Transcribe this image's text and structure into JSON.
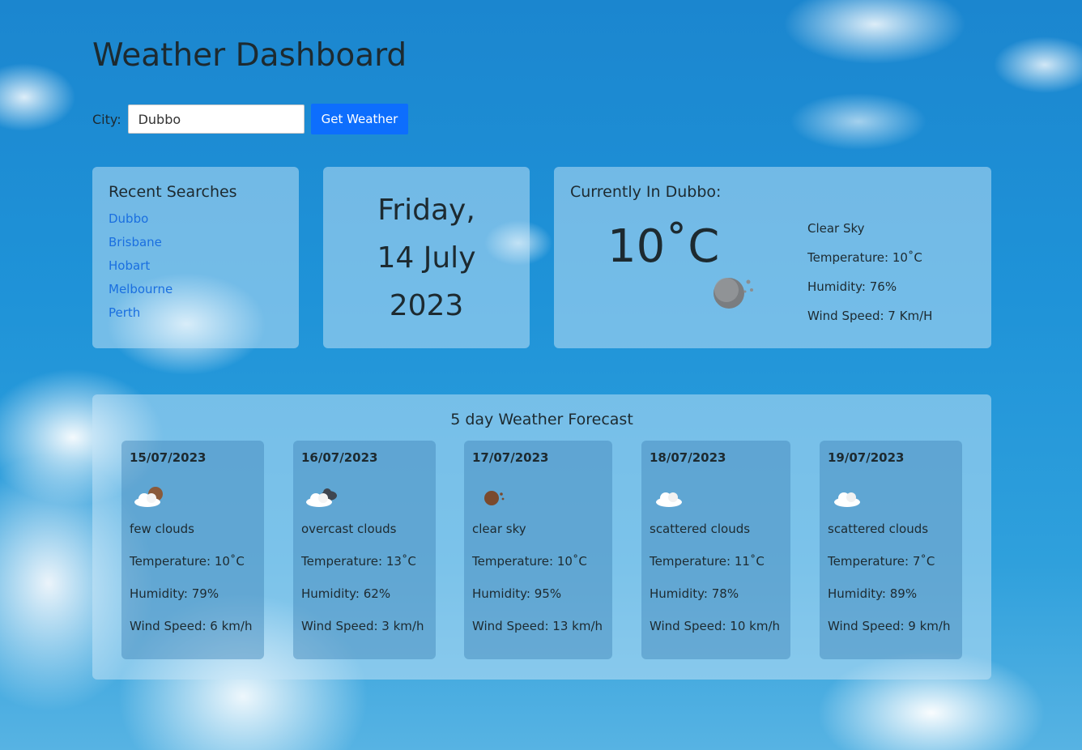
{
  "header": {
    "title": "Weather Dashboard"
  },
  "search": {
    "label": "City:",
    "value": "Dubbo",
    "button_label": "Get Weather"
  },
  "recent": {
    "title": "Recent Searches",
    "items": [
      "Dubbo",
      "Brisbane",
      "Hobart",
      "Melbourne",
      "Perth"
    ]
  },
  "date": {
    "line1": "Friday,",
    "line2": "14 July",
    "line3": "2023"
  },
  "current": {
    "title": "Currently In Dubbo:",
    "temp_big": "10˚C",
    "icon": "clear-night-icon",
    "description": "Clear Sky",
    "temperature": "Temperature: 10˚C",
    "humidity": "Humidity: 76%",
    "wind": "Wind Speed: 7 Km/H"
  },
  "forecast": {
    "title": "5 day Weather Forecast",
    "days": [
      {
        "date": "15/07/2023",
        "icon": "few-clouds-night-icon",
        "desc": "few clouds",
        "temp": "Temperature: 10˚C",
        "humidity": "Humidity: 79%",
        "wind": "Wind Speed: 6 km/h"
      },
      {
        "date": "16/07/2023",
        "icon": "overcast-clouds-icon",
        "desc": "overcast clouds",
        "temp": "Temperature: 13˚C",
        "humidity": "Humidity: 62%",
        "wind": "Wind Speed: 3 km/h"
      },
      {
        "date": "17/07/2023",
        "icon": "clear-night-icon",
        "desc": "clear sky",
        "temp": "Temperature: 10˚C",
        "humidity": "Humidity: 95%",
        "wind": "Wind Speed: 13 km/h"
      },
      {
        "date": "18/07/2023",
        "icon": "scattered-clouds-icon",
        "desc": "scattered clouds",
        "temp": "Temperature: 11˚C",
        "humidity": "Humidity: 78%",
        "wind": "Wind Speed: 10 km/h"
      },
      {
        "date": "19/07/2023",
        "icon": "scattered-clouds-icon",
        "desc": "scattered clouds",
        "temp": "Temperature: 7˚C",
        "humidity": "Humidity: 89%",
        "wind": "Wind Speed: 9 km/h"
      }
    ]
  }
}
